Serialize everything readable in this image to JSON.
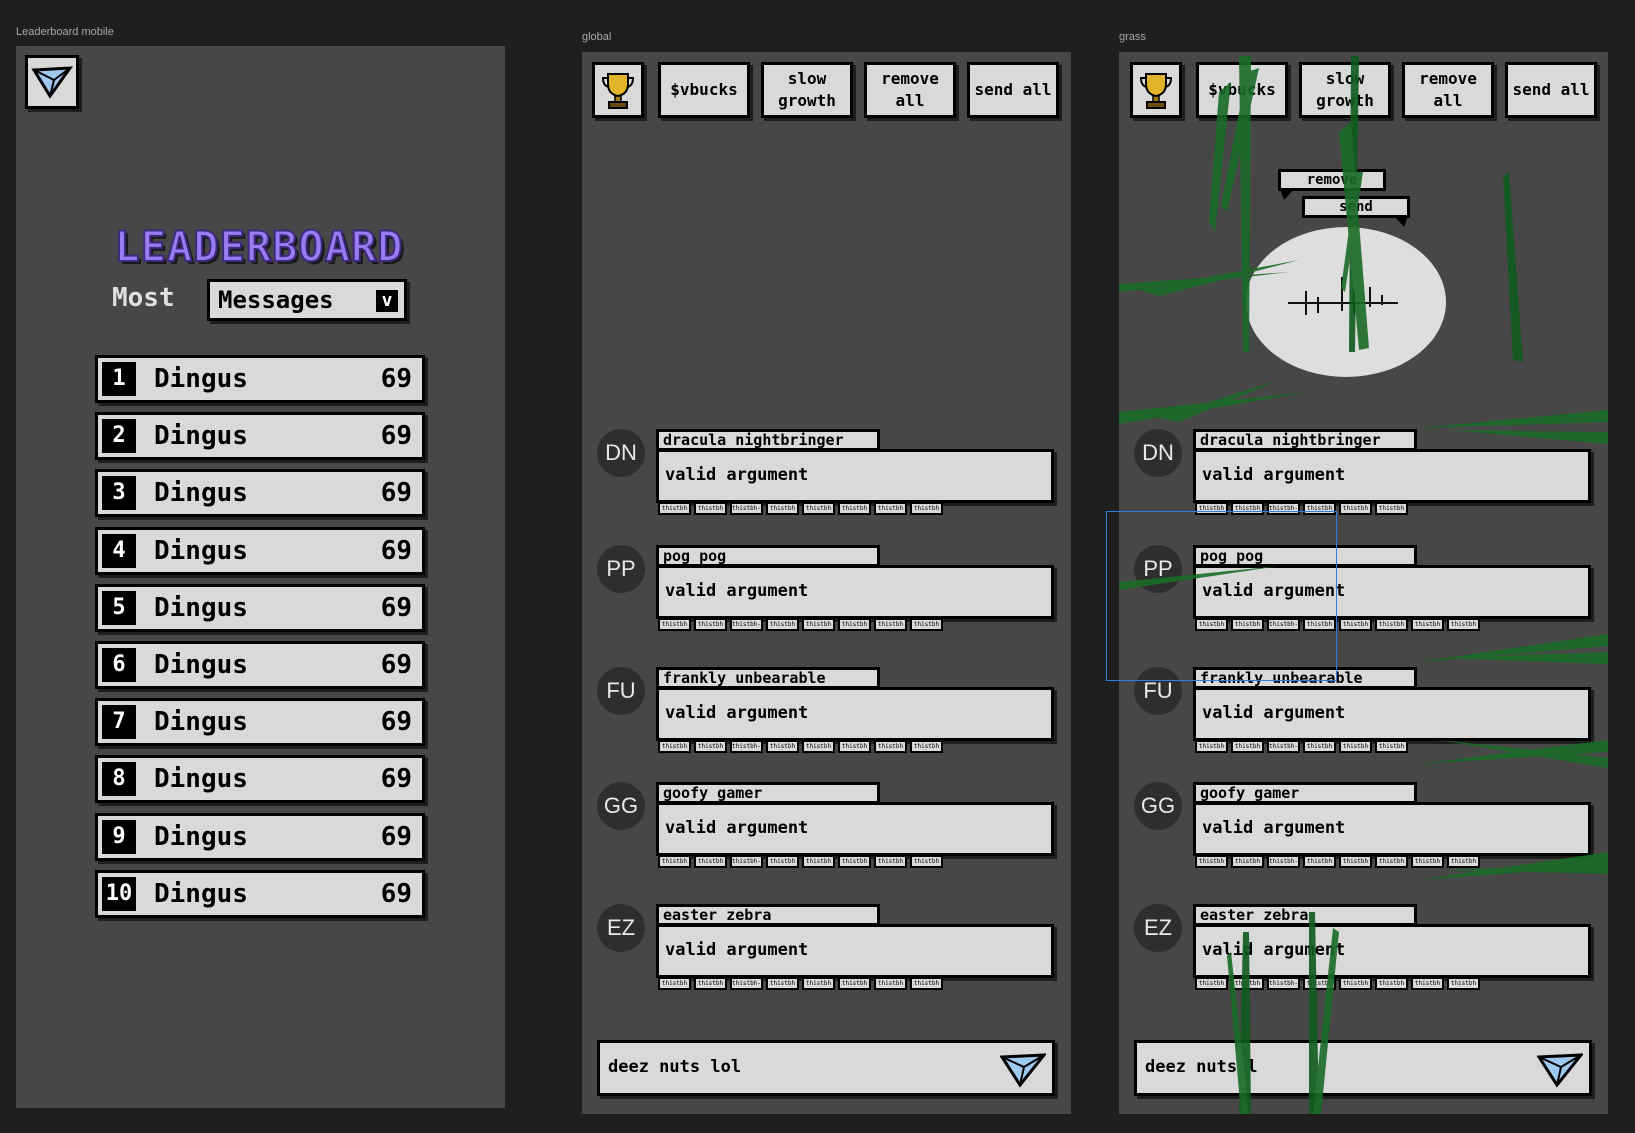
{
  "frames": {
    "leaderboard_label": "Leaderboard mobile",
    "global_label": "global",
    "grass_label": "grass"
  },
  "leaderboard": {
    "title": "LEADERBOARD",
    "most_label": "Most",
    "sort_select": "Messages",
    "sort_caret": "v",
    "rows": [
      {
        "rank": "1",
        "name": "Dingus",
        "score": "69"
      },
      {
        "rank": "2",
        "name": "Dingus",
        "score": "69"
      },
      {
        "rank": "3",
        "name": "Dingus",
        "score": "69"
      },
      {
        "rank": "4",
        "name": "Dingus",
        "score": "69"
      },
      {
        "rank": "5",
        "name": "Dingus",
        "score": "69"
      },
      {
        "rank": "6",
        "name": "Dingus",
        "score": "69"
      },
      {
        "rank": "7",
        "name": "Dingus",
        "score": "69"
      },
      {
        "rank": "8",
        "name": "Dingus",
        "score": "69"
      },
      {
        "rank": "9",
        "name": "Dingus",
        "score": "69"
      },
      {
        "rank": "10",
        "name": "Dingus",
        "score": "69"
      }
    ]
  },
  "toolbar": {
    "vbucks": "$vbucks",
    "slow_growth": "slow growth",
    "remove_all": "remove all",
    "send_all": "send all"
  },
  "messages": [
    {
      "initials": "DN",
      "name": "dracula nightbringer",
      "text": "valid argument"
    },
    {
      "initials": "PP",
      "name": "pog pog",
      "text": "valid argument"
    },
    {
      "initials": "FU",
      "name": "frankly unbearable",
      "text": "valid argument"
    },
    {
      "initials": "GG",
      "name": "goofy gamer",
      "text": "valid argument"
    },
    {
      "initials": "EZ",
      "name": "easter zebra",
      "text": "valid argument"
    }
  ],
  "reactions": [
    "thistbh",
    "thistbh",
    "thistbh-6",
    "thistbh",
    "thistbh",
    "thistbh",
    "thistbh",
    "thistbh"
  ],
  "composer": {
    "global_value": "deez nuts lol",
    "grass_value": "deez nuts l"
  },
  "grass_popup": {
    "remove": "remove",
    "send": "send"
  },
  "colors": {
    "accent_purple": "#9b7cf0",
    "grass_green": "#1f7a2e",
    "panel": "#474747",
    "canvas": "#1f1f1f",
    "selection": "#2f7fd8"
  },
  "icons": {
    "send": "paper-plane-icon",
    "leaderboard": "trophy-icon",
    "caret": "chevron-down-icon"
  }
}
